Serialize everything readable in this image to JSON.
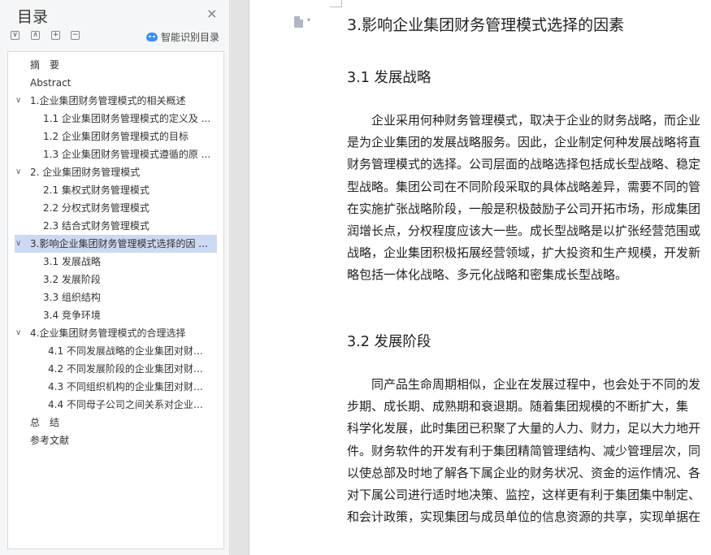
{
  "toc_panel": {
    "title": "目录",
    "close_glyph": "×",
    "tools": [
      "∨",
      "∧",
      "+",
      "−"
    ],
    "smart_label": "智能识别目录",
    "items": [
      {
        "label": "摘　要",
        "level": 1,
        "chevron": ""
      },
      {
        "label": "Abstract",
        "level": 1,
        "chevron": ""
      },
      {
        "label": "1.企业集团财务管理模式的相关概述",
        "level": 1,
        "chevron": "∨"
      },
      {
        "label": "1.1 企业集团财务管理模式的定义及 ...",
        "level": 2,
        "chevron": ""
      },
      {
        "label": "1.2 企业集团财务管理模式的目标",
        "level": 2,
        "chevron": ""
      },
      {
        "label": "1.3 企业集团财务管理模式遵循的原 ...",
        "level": 2,
        "chevron": ""
      },
      {
        "label": "2. 企业集团财务管理模式",
        "level": 1,
        "chevron": "∨"
      },
      {
        "label": "2.1  集权式财务管理模式",
        "level": 2,
        "chevron": ""
      },
      {
        "label": "2.2 分权式财务管理模式",
        "level": 2,
        "chevron": ""
      },
      {
        "label": "2.3 结合式财务管理模式",
        "level": 2,
        "chevron": ""
      },
      {
        "label": "3.影响企业集团财务管理模式选择的因 ...",
        "level": 1,
        "chevron": "∨",
        "selected": true
      },
      {
        "label": "3.1 发展战略",
        "level": 2,
        "chevron": ""
      },
      {
        "label": "3.2 发展阶段",
        "level": 2,
        "chevron": ""
      },
      {
        "label": "3.3 组织结构",
        "level": 2,
        "chevron": ""
      },
      {
        "label": "3.4  竞争环境",
        "level": 2,
        "chevron": ""
      },
      {
        "label": "4.企业集团财务管理模式的合理选择",
        "level": 1,
        "chevron": "∨"
      },
      {
        "label": "4.1 不同发展战略的企业集团对财务 ...",
        "level": 3,
        "chevron": ""
      },
      {
        "label": "4.2 不同发展阶段的企业集团对财务 ...",
        "level": 3,
        "chevron": ""
      },
      {
        "label": "4.3 不同组织机构的企业集团对财务 ...",
        "level": 3,
        "chevron": ""
      },
      {
        "label": "4.4 不同母子公司之间关系对企业集 ...",
        "level": 3,
        "chevron": ""
      },
      {
        "label": "总　结",
        "level": 1,
        "chevron": ""
      },
      {
        "label": "参考文献",
        "level": 1,
        "chevron": ""
      }
    ]
  },
  "document": {
    "caret": "▾",
    "heading": "3.影响企业集团财务管理模式选择的因素",
    "sections": [
      {
        "heading": "3.1 发展战略",
        "lines": [
          "　　企业采用何种财务管理模式，取决于企业的财务战略，而企业",
          "是为企业集团的发展战略服务。因此，企业制定何种发展战略将直",
          "财务管理模式的选择。公司层面的战略选择包括成长型战略、稳定",
          "型战略。集团公司在不同阶段采取的具体战略差异，需要不同的管",
          "在实施扩张战略阶段，一般是积极鼓励子公司开拓市场，形成集团",
          "润增长点，分权程度应该大一些。成长型战略是以扩张经营范围或",
          "战略，企业集团积极拓展经营领域，扩大投资和生产规模，开发新",
          "略包括一体化战略、多元化战略和密集成长型战略。"
        ]
      },
      {
        "heading": "3.2 发展阶段",
        "lines": [
          "　　同产品生命周期相似，企业在发展过程中，也会处于不同的发",
          "步期、成长期、成熟期和衰退期。随着集团规模的不断扩大，集",
          "科学化发展，此时集团已积聚了大量的人力、财力，足以大力地开",
          "件。财务软件的开发有利于集团精简管理结构、减少管理层次，同",
          "以使总部及时地了解各下属企业的财务状况、资金的运作情况、各",
          "对下属公司进行适时地决策、监控，这样更有利于集团集中制定、",
          "和会计政策，实现集团与成员单位的信息资源的共享，实现单据在"
        ]
      }
    ]
  }
}
